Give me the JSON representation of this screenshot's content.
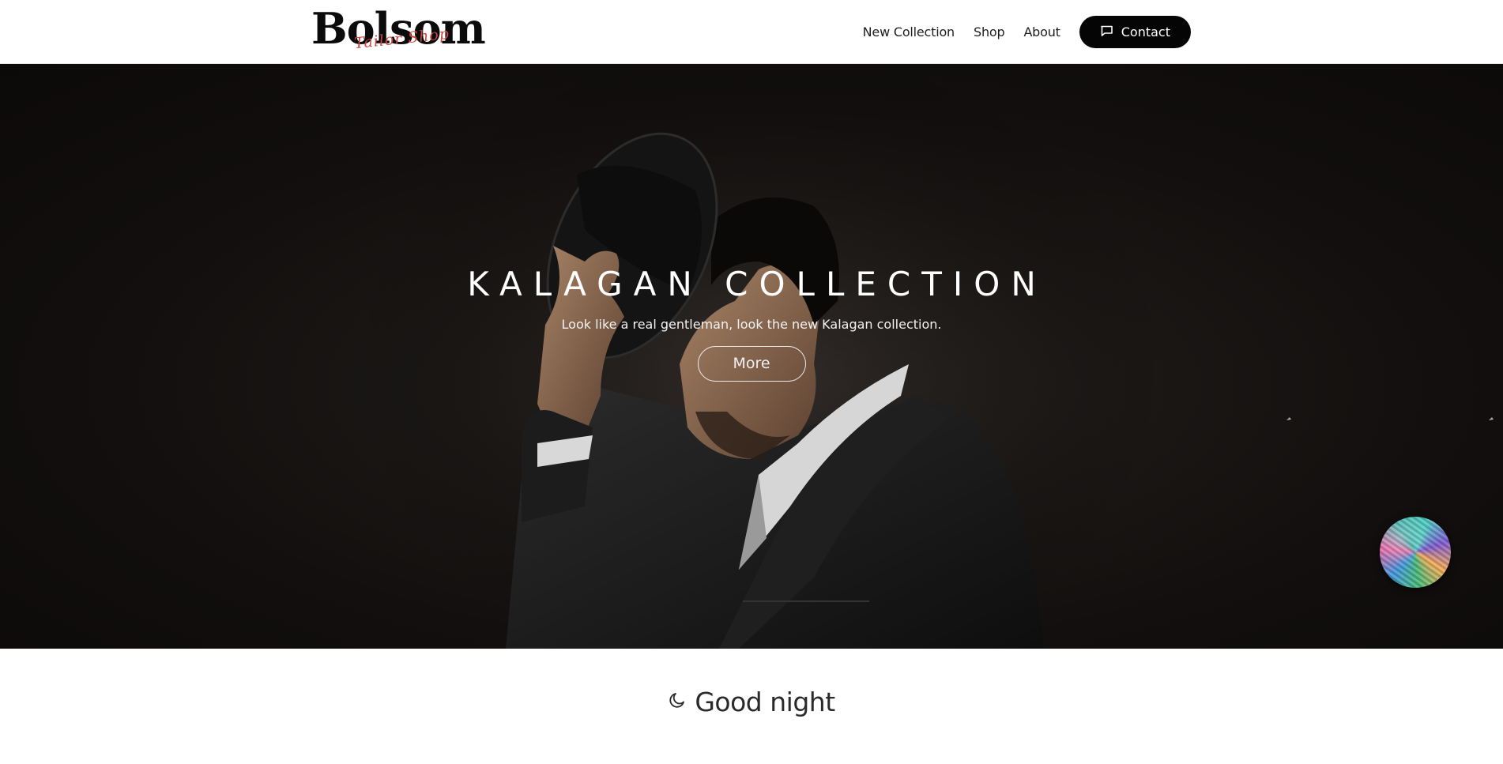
{
  "header": {
    "logo_main": "Bolsom",
    "logo_script": "Tailor Shop",
    "nav": {
      "new_collection": "New Collection",
      "shop": "Shop",
      "about": "About"
    },
    "contact_label": "Contact",
    "contact_icon": "chat-bubble-icon"
  },
  "hero": {
    "title": "KALAGAN COLLECTION",
    "subtitle": "Look like a real gentleman, look the new Kalagan collection.",
    "button_label": "More"
  },
  "greeting": {
    "icon": "moon-icon",
    "text": "Good night"
  },
  "colors": {
    "header_bg": "#ffffff",
    "button_dark": "#050505",
    "hero_bg": "#141110",
    "logo_accent": "#c9473f"
  }
}
